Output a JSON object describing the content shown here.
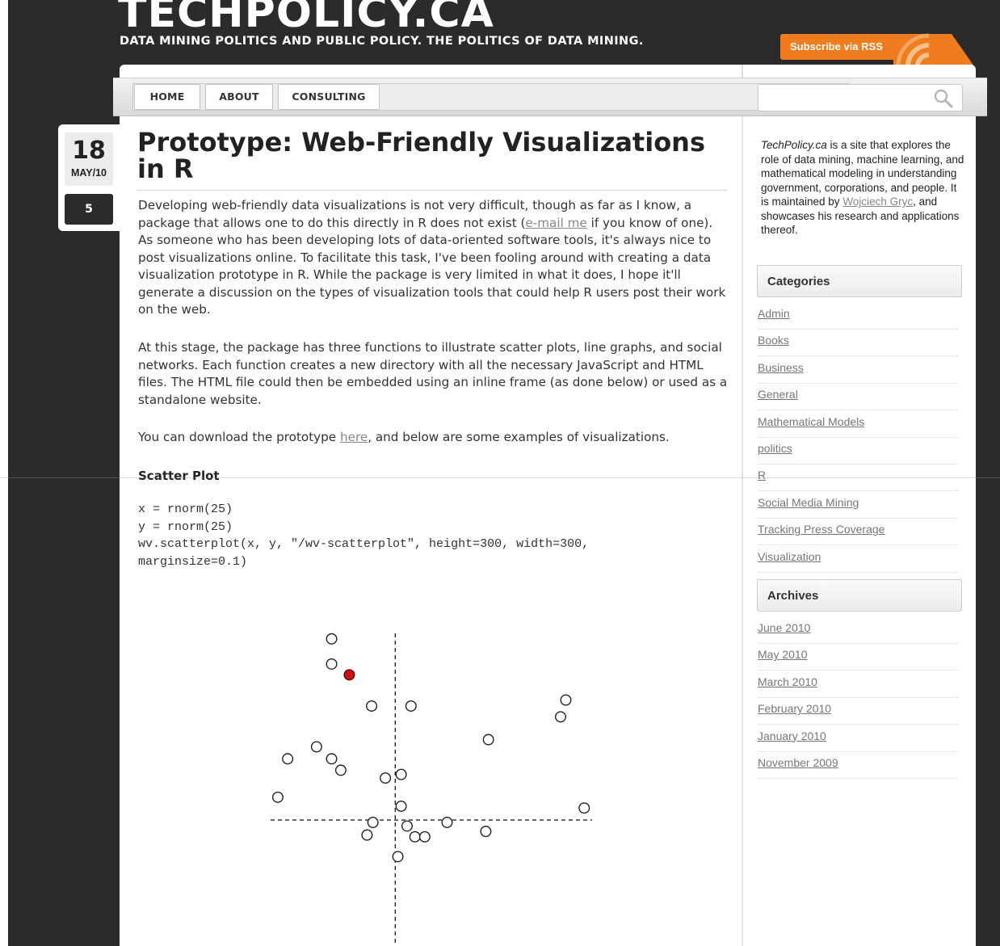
{
  "header": {
    "site_title": "TECHPOLICY.CA",
    "tagline": "DATA MINING POLITICS AND PUBLIC POLICY. THE POLITICS OF DATA MINING.",
    "rss_label": "Subscribe via RSS",
    "rss_icon": "rss-feed-icon"
  },
  "nav": {
    "items": [
      {
        "label": "HOME"
      },
      {
        "label": "ABOUT"
      },
      {
        "label": "CONSULTING"
      }
    ],
    "search_placeholder": "",
    "search_icon": "magnifier-icon"
  },
  "post": {
    "day": "18",
    "month": "MAY/10",
    "comments": "5",
    "title": "Prototype: Web-Friendly Visualizations in R",
    "p1_a": "Developing web-friendly data visualizations is not very difficult, though as far as I know, a package that allows one to do this directly in R does not exist (",
    "p1_link": "e-mail me",
    "p1_b": " if you know of one). As someone who has been developing lots of data-oriented software tools, it's always nice to post visualizations online. To facilitate this task, I've been fooling around with creating a data visualization prototype in R. While the package is very limited in what it does, I hope it'll generate a discussion on the types of visualization tools that could help R users post their work on the web.",
    "p2": "At this stage, the package has three functions to illustrate scatter plots, line graphs, and social networks. Each function creates a new directory with all the necessary JavaScript and HTML files. The HTML file could then be embedded using an inline frame (as done below) or used as a standalone website.",
    "p3_a": "You can download the prototype ",
    "p3_link": "here",
    "p3_b": ", and below are some examples of visualizations.",
    "scatter_heading": "Scatter Plot",
    "code": "x = rnorm(25)\ny = rnorm(25)\nwv.scatterplot(x, y, \"/wv-scatterplot\", height=300, width=300,\nmarginsize=0.1)"
  },
  "sidebar": {
    "about_site": "TechPolicy.ca",
    "about_a": " is a site that explores the role of data mining, machine learning, and mathematical modeling in understanding government, corporations, and people. It is maintained by ",
    "about_link": "Wojciech Gryc",
    "about_b": ", and showcases his research and applications thereof.",
    "categories_title": "Categories",
    "categories": [
      "Admin",
      "Books",
      "Business",
      "General",
      "Mathematical Models",
      "politics",
      "R",
      "Social Media Mining",
      "Tracking Press Coverage",
      "Visualization"
    ],
    "archives_title": "Archives",
    "archives": [
      "June 2010",
      "May 2010",
      "March 2010",
      "February 2010",
      "January 2010",
      "November 2009"
    ]
  },
  "colors": {
    "rss_orange": "#ef7c1e",
    "highlight_point": "#cc1111",
    "dark_bg": "#2b2b2b"
  },
  "chart_data": {
    "type": "scatter",
    "title": "",
    "xlabel": "",
    "ylabel": "",
    "grid": false,
    "reference_lines": "dashed crosshair at x=0, y=0",
    "xlim": [
      -1.9,
      3.0
    ],
    "ylim": [
      -2.1,
      3.3
    ],
    "highlighted_index": 2,
    "points": [
      {
        "x": -0.97,
        "y": 3.02
      },
      {
        "x": -0.97,
        "y": 2.6
      },
      {
        "x": -0.7,
        "y": 2.42
      },
      {
        "x": -0.36,
        "y": 1.9
      },
      {
        "x": 0.24,
        "y": 1.9
      },
      {
        "x": 2.6,
        "y": 2.0
      },
      {
        "x": 2.52,
        "y": 1.72
      },
      {
        "x": 1.42,
        "y": 1.34
      },
      {
        "x": -1.2,
        "y": 1.22
      },
      {
        "x": -1.64,
        "y": 1.02
      },
      {
        "x": -0.97,
        "y": 1.02
      },
      {
        "x": -0.83,
        "y": 0.83
      },
      {
        "x": -0.15,
        "y": 0.7
      },
      {
        "x": 0.09,
        "y": 0.76
      },
      {
        "x": -1.79,
        "y": 0.38
      },
      {
        "x": 0.09,
        "y": 0.23
      },
      {
        "x": 2.88,
        "y": 0.2
      },
      {
        "x": -0.34,
        "y": -0.04
      },
      {
        "x": 0.18,
        "y": -0.1
      },
      {
        "x": 0.79,
        "y": -0.04
      },
      {
        "x": -0.43,
        "y": -0.25
      },
      {
        "x": 0.3,
        "y": -0.28
      },
      {
        "x": 0.45,
        "y": -0.28
      },
      {
        "x": 1.38,
        "y": -0.19
      },
      {
        "x": 0.04,
        "y": -0.61
      }
    ]
  }
}
